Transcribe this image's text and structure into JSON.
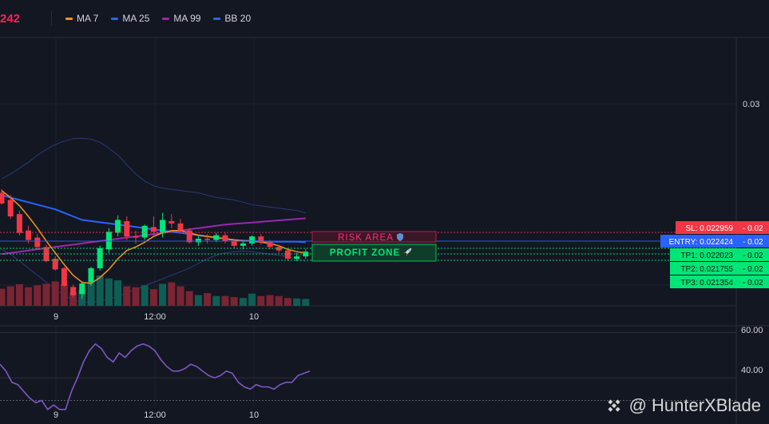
{
  "header": {
    "price_fragment": "242",
    "legend": [
      {
        "name": "MA 7",
        "color": "#f7931a"
      },
      {
        "name": "MA 25",
        "color": "#2962ff"
      },
      {
        "name": "MA 99",
        "color": "#9c27b0"
      },
      {
        "name": "BB 20",
        "color": "#1e3a8a"
      }
    ]
  },
  "price_axis": {
    "label_03": "0.03"
  },
  "time_axis": {
    "labels": [
      "9",
      "12:00",
      "10"
    ]
  },
  "rsi_axis": {
    "labels": [
      "60.00",
      "40.00"
    ]
  },
  "zones": {
    "risk_label": "RISK AREA",
    "risk_icon": "shield-icon",
    "profit_label": "PROFIT ZONE",
    "profit_icon": "rocket-icon"
  },
  "levels": [
    {
      "label": "SL: 0.022959",
      "value": "0.02",
      "color": "#f23645"
    },
    {
      "label": "ENTRY: 0.022424",
      "value": "0.02",
      "color": "#2962ff"
    },
    {
      "label": "TP1: 0.022023",
      "value": "0.02",
      "color": "#00e676"
    },
    {
      "label": "TP2: 0.021755",
      "value": "0.02",
      "color": "#00e676"
    },
    {
      "label": "TP3: 0.021354",
      "value": "0.02",
      "color": "#00e676"
    }
  ],
  "watermark": {
    "text": "@ HunterXBlade",
    "icon": "binance-logo-icon"
  },
  "chart_data": [
    {
      "type": "candlestick",
      "title": "",
      "overlays": [
        "MA 7",
        "MA 25",
        "MA 99",
        "BB 20"
      ],
      "x_ticks": [
        "9",
        "12:00",
        "10"
      ],
      "candles": [
        {
          "o": 0.0244,
          "h": 0.02455,
          "l": 0.0239,
          "c": 0.02395
        },
        {
          "o": 0.0241,
          "h": 0.0243,
          "l": 0.0233,
          "c": 0.0234
        },
        {
          "o": 0.0235,
          "h": 0.02365,
          "l": 0.0226,
          "c": 0.0227
        },
        {
          "o": 0.0228,
          "h": 0.023,
          "l": 0.02225,
          "c": 0.0224
        },
        {
          "o": 0.0225,
          "h": 0.02265,
          "l": 0.022,
          "c": 0.0221
        },
        {
          "o": 0.0221,
          "h": 0.0222,
          "l": 0.02145,
          "c": 0.0215
        },
        {
          "o": 0.0216,
          "h": 0.0217,
          "l": 0.0211,
          "c": 0.02115
        },
        {
          "o": 0.0212,
          "h": 0.02125,
          "l": 0.0204,
          "c": 0.02045
        },
        {
          "o": 0.0204,
          "h": 0.0205,
          "l": 0.01995,
          "c": 0.02005
        },
        {
          "o": 0.0201,
          "h": 0.0206,
          "l": 0.0199,
          "c": 0.02055
        },
        {
          "o": 0.0206,
          "h": 0.02125,
          "l": 0.02045,
          "c": 0.0212
        },
        {
          "o": 0.0212,
          "h": 0.02215,
          "l": 0.0211,
          "c": 0.02205
        },
        {
          "o": 0.022,
          "h": 0.0229,
          "l": 0.02185,
          "c": 0.02275
        },
        {
          "o": 0.0227,
          "h": 0.02345,
          "l": 0.02255,
          "c": 0.02325
        },
        {
          "o": 0.0232,
          "h": 0.0234,
          "l": 0.0224,
          "c": 0.02255
        },
        {
          "o": 0.02255,
          "h": 0.0228,
          "l": 0.02225,
          "c": 0.0225
        },
        {
          "o": 0.0225,
          "h": 0.02305,
          "l": 0.0224,
          "c": 0.023
        },
        {
          "o": 0.02295,
          "h": 0.0234,
          "l": 0.0226,
          "c": 0.02275
        },
        {
          "o": 0.0227,
          "h": 0.02355,
          "l": 0.0225,
          "c": 0.02325
        },
        {
          "o": 0.0232,
          "h": 0.0235,
          "l": 0.0229,
          "c": 0.0231
        },
        {
          "o": 0.0231,
          "h": 0.0233,
          "l": 0.0227,
          "c": 0.0228
        },
        {
          "o": 0.0228,
          "h": 0.0229,
          "l": 0.02225,
          "c": 0.0223
        },
        {
          "o": 0.0223,
          "h": 0.02255,
          "l": 0.02215,
          "c": 0.02245
        },
        {
          "o": 0.02245,
          "h": 0.02265,
          "l": 0.02225,
          "c": 0.0224
        },
        {
          "o": 0.0224,
          "h": 0.0227,
          "l": 0.0223,
          "c": 0.0226
        },
        {
          "o": 0.0226,
          "h": 0.0227,
          "l": 0.02225,
          "c": 0.02235
        },
        {
          "o": 0.02235,
          "h": 0.02245,
          "l": 0.02205,
          "c": 0.02215
        },
        {
          "o": 0.02215,
          "h": 0.02235,
          "l": 0.022,
          "c": 0.02225
        },
        {
          "o": 0.02225,
          "h": 0.0226,
          "l": 0.02215,
          "c": 0.02255
        },
        {
          "o": 0.02255,
          "h": 0.02265,
          "l": 0.0222,
          "c": 0.0223
        },
        {
          "o": 0.0223,
          "h": 0.0224,
          "l": 0.022,
          "c": 0.0221
        },
        {
          "o": 0.0221,
          "h": 0.02215,
          "l": 0.02185,
          "c": 0.02195
        },
        {
          "o": 0.02195,
          "h": 0.022,
          "l": 0.0215,
          "c": 0.0216
        },
        {
          "o": 0.0216,
          "h": 0.02185,
          "l": 0.0215,
          "c": 0.0217
        },
        {
          "o": 0.0217,
          "h": 0.022,
          "l": 0.0216,
          "c": 0.0219
        }
      ],
      "volume": [
        35,
        40,
        44,
        38,
        42,
        45,
        50,
        44,
        28,
        33,
        48,
        62,
        56,
        52,
        40,
        38,
        42,
        34,
        45,
        48,
        40,
        30,
        22,
        26,
        20,
        20,
        18,
        16,
        25,
        20,
        22,
        20,
        16,
        15,
        14
      ],
      "ma7": [
        0.0245,
        0.0242,
        0.02385,
        0.0234,
        0.0229,
        0.02235,
        0.02185,
        0.02135,
        0.0209,
        0.0206,
        0.02055,
        0.0208,
        0.02115,
        0.0216,
        0.02195,
        0.0221,
        0.0223,
        0.02255,
        0.0227,
        0.0228,
        0.0228,
        0.0227,
        0.0226,
        0.02255,
        0.0225,
        0.02245,
        0.0224,
        0.02235,
        0.02235,
        0.0223,
        0.02225,
        0.02215,
        0.022,
        0.0219,
        0.02185
      ],
      "ma25": [
        0.0243,
        0.0242,
        0.0241,
        0.024,
        0.0239,
        0.0238,
        0.0237,
        0.02355,
        0.0234,
        0.02325,
        0.0232,
        0.02315,
        0.0231,
        0.02305,
        0.023,
        0.02295,
        0.0229,
        0.02285,
        0.0228,
        0.02275,
        0.0227,
        0.02265,
        0.0226,
        0.02255,
        0.0225,
        0.02245,
        0.0224,
        0.02238,
        0.02236,
        0.02234,
        0.02232,
        0.02232,
        0.02232,
        0.02232,
        0.0223
      ],
      "ma99": [
        0.0218,
        0.02185,
        0.0219,
        0.02195,
        0.022,
        0.02205,
        0.0221,
        0.02215,
        0.0222,
        0.02225,
        0.0223,
        0.02235,
        0.0224,
        0.02245,
        0.0225,
        0.02255,
        0.0226,
        0.02265,
        0.0227,
        0.02275,
        0.0228,
        0.02285,
        0.0229,
        0.02295,
        0.023,
        0.02305,
        0.02308,
        0.02311,
        0.02314,
        0.02317,
        0.0232,
        0.02323,
        0.02326,
        0.02329,
        0.02332
      ],
      "bb_upper": [
        0.025,
        0.0252,
        0.02545,
        0.0257,
        0.026,
        0.02625,
        0.02645,
        0.0266,
        0.0267,
        0.02672,
        0.02668,
        0.02655,
        0.0263,
        0.026,
        0.0256,
        0.0252,
        0.0249,
        0.0247,
        0.0246,
        0.02455,
        0.0245,
        0.02445,
        0.0244,
        0.0243,
        0.0242,
        0.02415,
        0.0241,
        0.024,
        0.0239,
        0.02385,
        0.0238,
        0.02375,
        0.0237,
        0.02365,
        0.02355
      ],
      "bb_lower": [
        0.022,
        0.0218,
        0.0215,
        0.0212,
        0.0209,
        0.0206,
        0.0203,
        0.02005,
        0.01985,
        0.01975,
        0.01975,
        0.0198,
        0.0199,
        0.02,
        0.02015,
        0.0203,
        0.02045,
        0.0206,
        0.02075,
        0.0209,
        0.02105,
        0.0212,
        0.0214,
        0.0216,
        0.02175,
        0.02185,
        0.0219,
        0.02192,
        0.0219,
        0.02185,
        0.0218,
        0.02175,
        0.02168,
        0.0216,
        0.0215
      ],
      "levels": {
        "sl": 0.022959,
        "entry": 0.022424,
        "tp1": 0.022023,
        "tp2": 0.021755,
        "tp3": 0.021354
      },
      "ylim": [
        0.0196,
        0.031
      ]
    },
    {
      "type": "line",
      "name": "",
      "values": [
        46,
        43,
        38,
        37,
        34,
        31,
        29,
        30,
        26,
        28,
        26,
        26,
        34,
        40,
        47,
        52,
        55,
        53,
        49,
        47,
        51,
        49,
        52,
        54,
        55,
        54,
        52,
        48,
        45,
        43,
        43,
        44,
        46,
        45,
        43,
        41,
        40,
        41,
        43,
        42,
        38,
        36,
        35,
        37,
        36,
        36,
        35,
        37,
        38,
        38,
        41,
        42,
        43
      ],
      "grid": [
        60,
        40,
        30
      ],
      "ylim": [
        27,
        63
      ]
    }
  ]
}
